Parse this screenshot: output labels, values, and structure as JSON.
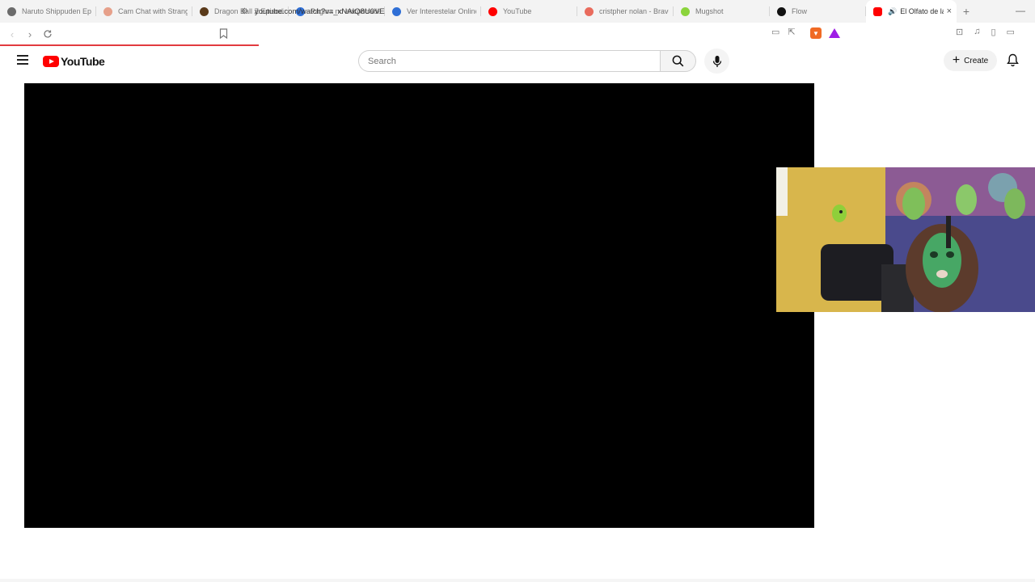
{
  "browser": {
    "tabs": [
      {
        "title": "Naruto Shippuden Epi",
        "fav_color": "#6b6b6b"
      },
      {
        "title": "Cam Chat with Strange",
        "fav_color": "#e6a08a"
      },
      {
        "title": "Dragon Ball Z Episodio",
        "fav_color": "#5a3a1a"
      },
      {
        "title": "Página no encontrada",
        "fav_color": "#2f6fd6"
      },
      {
        "title": "Ver Interestelar Online",
        "fav_color": "#2f6fd6"
      },
      {
        "title": "YouTube",
        "fav_color": "#ff0000"
      },
      {
        "title": "cristpher nolan - Brave",
        "fav_color": "#e96b5d"
      },
      {
        "title": "Mugshot",
        "fav_color": "#8bd43c"
      },
      {
        "title": "Flow",
        "fav_color": "#111111"
      }
    ],
    "active_tab": {
      "title": "El Olfato de la",
      "fav_color": "#ff0000"
    },
    "address": "youtube.com/watch?v=_xNAIQ8U0VE",
    "loading_progress": 0.25
  },
  "youtube": {
    "logo_text": "YouTube",
    "search_placeholder": "Search",
    "create_label": "Create"
  },
  "colors": {
    "accent": "#ff0000",
    "loading": "#e23b40",
    "brave": "#f06a24",
    "rewards": "#9e1de5"
  }
}
